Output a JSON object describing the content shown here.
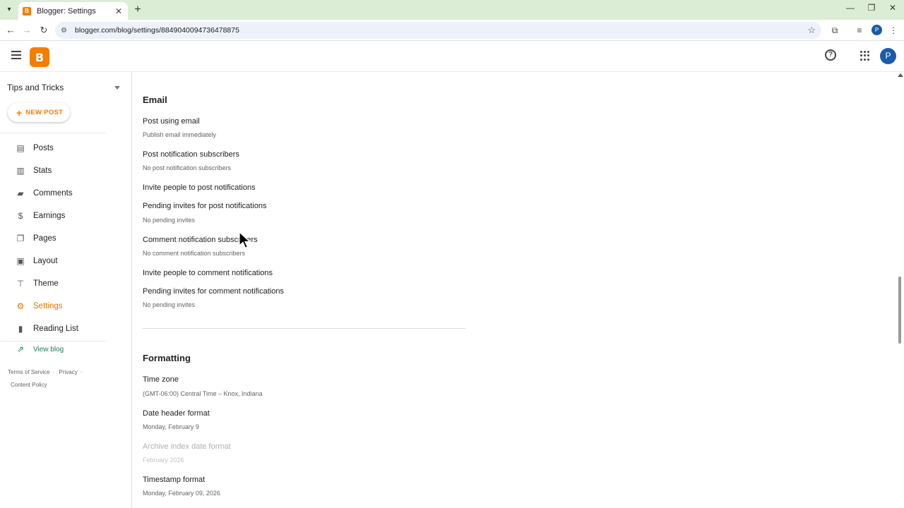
{
  "browser": {
    "tab_title": "Blogger: Settings",
    "url": "blogger.com/blog/settings/8849040094736478875",
    "profile_initial": "P"
  },
  "app": {
    "avatar_initial": "P",
    "logo_letter": "B"
  },
  "sidebar": {
    "blog_name": "Tips and Tricks",
    "new_post_label": "NEW POST",
    "items": [
      {
        "label": "Posts",
        "icon": "posts-icon"
      },
      {
        "label": "Stats",
        "icon": "stats-icon"
      },
      {
        "label": "Comments",
        "icon": "comments-icon"
      },
      {
        "label": "Earnings",
        "icon": "dollar-icon"
      },
      {
        "label": "Pages",
        "icon": "pages-icon"
      },
      {
        "label": "Layout",
        "icon": "layout-icon"
      },
      {
        "label": "Theme",
        "icon": "paint-roller-icon"
      },
      {
        "label": "Settings",
        "icon": "gear-icon"
      },
      {
        "label": "Reading List",
        "icon": "bookmark-icon"
      }
    ],
    "view_blog_label": "View blog",
    "footer": {
      "terms": "Terms of Service",
      "privacy": "Privacy",
      "content_policy": "Content Policy"
    }
  },
  "email_section": {
    "title": "Email",
    "post_using_email": {
      "title": "Post using email",
      "sub": "Publish email immediately"
    },
    "post_notification_subscribers": {
      "title": "Post notification subscribers",
      "sub": "No post notification subscribers"
    },
    "invite_post_notifications": {
      "title": "Invite people to post notifications"
    },
    "pending_post_invites": {
      "title": "Pending invites for post notifications",
      "sub": "No pending invites"
    },
    "comment_notification_subscribers": {
      "title": "Comment notification subscribers",
      "sub": "No comment notification subscribers"
    },
    "invite_comment_notifications": {
      "title": "Invite people to comment notifications"
    },
    "pending_comment_invites": {
      "title": "Pending invites for comment notifications",
      "sub": "No pending invites"
    }
  },
  "formatting_section": {
    "title": "Formatting",
    "time_zone": {
      "title": "Time zone",
      "sub": "(GMT-06:00) Central Time – Knox, Indiana"
    },
    "date_header_format": {
      "title": "Date header format",
      "sub": "Monday, February 9"
    },
    "archive_index_date_format": {
      "title": "Archive index date format",
      "sub": "February 2026"
    },
    "timestamp_format": {
      "title": "Timestamp format",
      "sub": "Monday, February 09, 2026"
    }
  },
  "colors": {
    "accent": "#f57d00",
    "active_nav": "#e37400",
    "view_blog": "#1e7d5a"
  }
}
